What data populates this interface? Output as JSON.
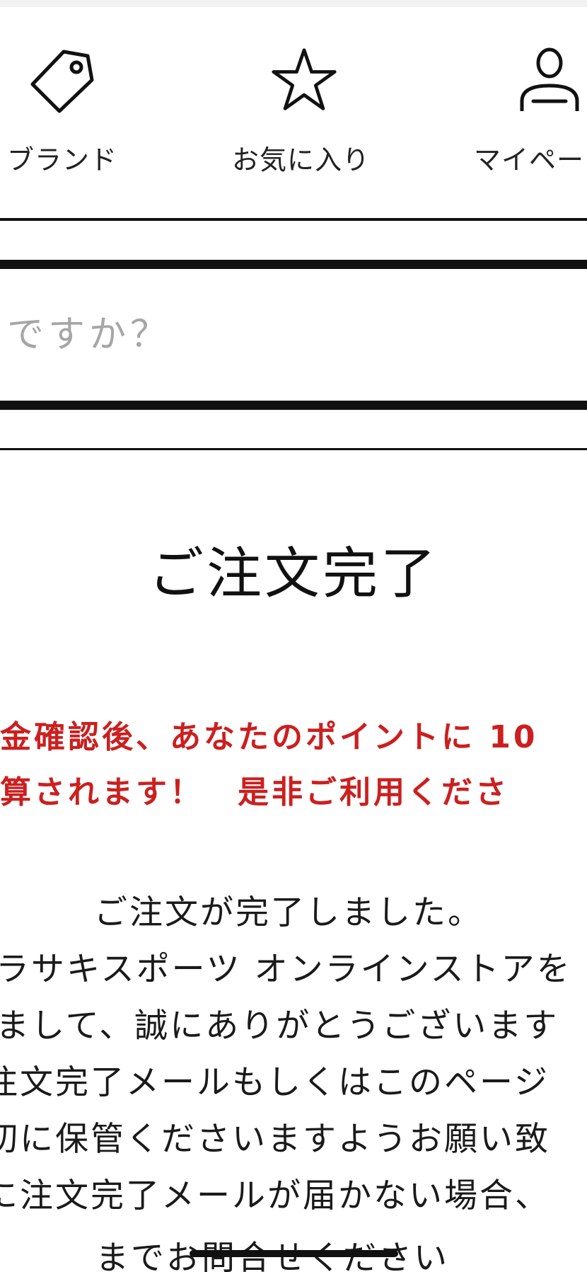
{
  "nav": {
    "brand": {
      "icon": "tag-icon",
      "label": "ブランド"
    },
    "favorites": {
      "icon": "star-icon",
      "label": "お気に入り"
    },
    "mypage": {
      "icon": "user-icon",
      "label": "マイペー"
    }
  },
  "search": {
    "partial_prompt": "ですか？"
  },
  "main": {
    "title": "ご注文完了",
    "notice": {
      "color": "#cc1f1f",
      "line1": "金確認後、あなたのポイントに 10",
      "line2": "算されます！　是非ご利用くださ"
    },
    "message_lines": [
      "ご注文が完了しました。",
      "ラサキスポーツ オンラインストアを",
      "まして、誠にありがとうございます",
      "注文完了メールもしくはこのページ",
      "切に保管くださいますようお願い致",
      "に注文完了メールが届かない場合、",
      "までお問合せください"
    ]
  }
}
